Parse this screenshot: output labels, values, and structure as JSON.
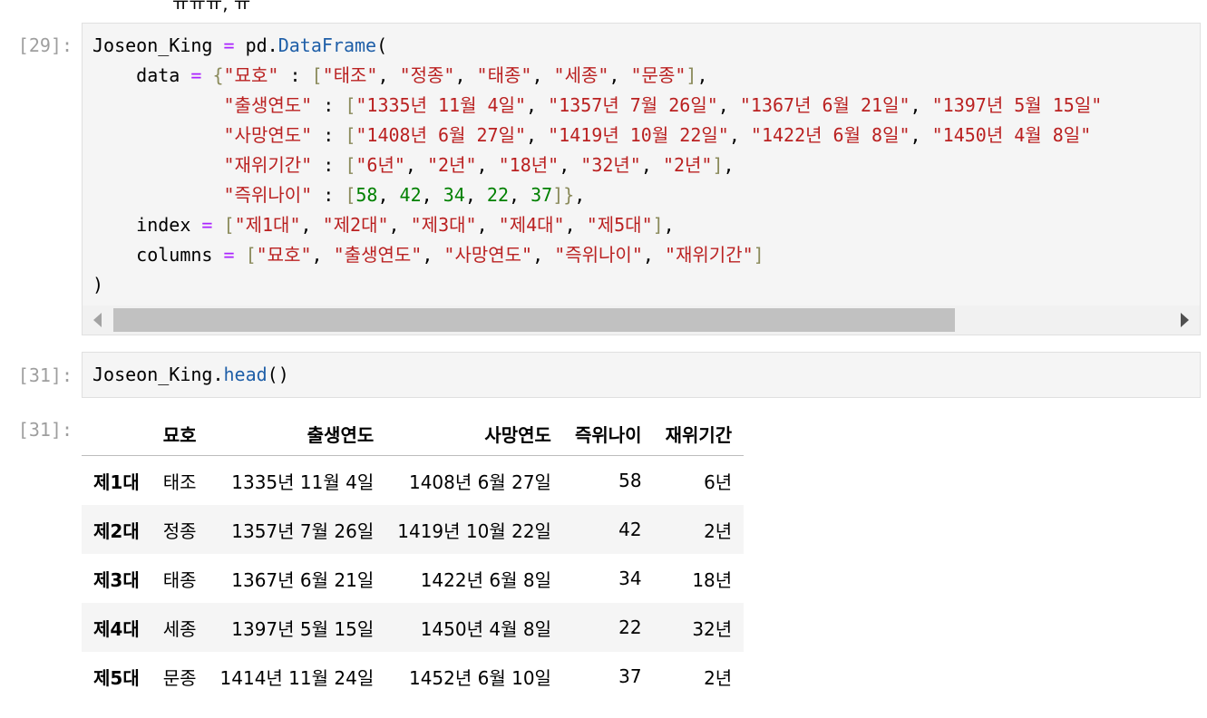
{
  "top_fragment": "ㅠㅠㅠ, ㅠ",
  "cells": [
    {
      "prompt": "[29]:",
      "code_lines": [
        [
          [
            "var",
            "Joseon_King "
          ],
          [
            "op",
            "="
          ],
          [
            "var",
            " pd."
          ],
          [
            "fn",
            "DataFrame"
          ],
          [
            "br",
            "("
          ]
        ],
        [
          [
            "var",
            "    data "
          ],
          [
            "op",
            "="
          ],
          [
            "var",
            " "
          ],
          [
            "brc",
            "{"
          ],
          [
            "str",
            "\"묘호\""
          ],
          [
            "var",
            " : "
          ],
          [
            "brc",
            "["
          ],
          [
            "str",
            "\"태조\""
          ],
          [
            "var",
            ", "
          ],
          [
            "str",
            "\"정종\""
          ],
          [
            "var",
            ", "
          ],
          [
            "str",
            "\"태종\""
          ],
          [
            "var",
            ", "
          ],
          [
            "str",
            "\"세종\""
          ],
          [
            "var",
            ", "
          ],
          [
            "str",
            "\"문종\""
          ],
          [
            "brc",
            "]"
          ],
          [
            "var",
            ","
          ]
        ],
        [
          [
            "var",
            "            "
          ],
          [
            "str",
            "\"출생연도\""
          ],
          [
            "var",
            " : "
          ],
          [
            "brc",
            "["
          ],
          [
            "str",
            "\"1335년 11월 4일\""
          ],
          [
            "var",
            ", "
          ],
          [
            "str",
            "\"1357년 7월 26일\""
          ],
          [
            "var",
            ", "
          ],
          [
            "str",
            "\"1367년 6월 21일\""
          ],
          [
            "var",
            ", "
          ],
          [
            "str",
            "\"1397년 5월 15일\""
          ]
        ],
        [
          [
            "var",
            "            "
          ],
          [
            "str",
            "\"사망연도\""
          ],
          [
            "var",
            " : "
          ],
          [
            "brc",
            "["
          ],
          [
            "str",
            "\"1408년 6월 27일\""
          ],
          [
            "var",
            ", "
          ],
          [
            "str",
            "\"1419년 10월 22일\""
          ],
          [
            "var",
            ", "
          ],
          [
            "str",
            "\"1422년 6월 8일\""
          ],
          [
            "var",
            ", "
          ],
          [
            "str",
            "\"1450년 4월 8일\""
          ]
        ],
        [
          [
            "var",
            "            "
          ],
          [
            "str",
            "\"재위기간\""
          ],
          [
            "var",
            " : "
          ],
          [
            "brc",
            "["
          ],
          [
            "str",
            "\"6년\""
          ],
          [
            "var",
            ", "
          ],
          [
            "str",
            "\"2년\""
          ],
          [
            "var",
            ", "
          ],
          [
            "str",
            "\"18년\""
          ],
          [
            "var",
            ", "
          ],
          [
            "str",
            "\"32년\""
          ],
          [
            "var",
            ", "
          ],
          [
            "str",
            "\"2년\""
          ],
          [
            "brc",
            "]"
          ],
          [
            "var",
            ","
          ]
        ],
        [
          [
            "var",
            "            "
          ],
          [
            "str",
            "\"즉위나이\""
          ],
          [
            "var",
            " : "
          ],
          [
            "brc",
            "["
          ],
          [
            "num",
            "58"
          ],
          [
            "var",
            ", "
          ],
          [
            "num",
            "42"
          ],
          [
            "var",
            ", "
          ],
          [
            "num",
            "34"
          ],
          [
            "var",
            ", "
          ],
          [
            "num",
            "22"
          ],
          [
            "var",
            ", "
          ],
          [
            "num",
            "37"
          ],
          [
            "brc",
            "]}"
          ],
          [
            "var",
            ","
          ]
        ],
        [
          [
            "var",
            "    index "
          ],
          [
            "op",
            "="
          ],
          [
            "var",
            " "
          ],
          [
            "brc",
            "["
          ],
          [
            "str",
            "\"제1대\""
          ],
          [
            "var",
            ", "
          ],
          [
            "str",
            "\"제2대\""
          ],
          [
            "var",
            ", "
          ],
          [
            "str",
            "\"제3대\""
          ],
          [
            "var",
            ", "
          ],
          [
            "str",
            "\"제4대\""
          ],
          [
            "var",
            ", "
          ],
          [
            "str",
            "\"제5대\""
          ],
          [
            "brc",
            "]"
          ],
          [
            "var",
            ","
          ]
        ],
        [
          [
            "var",
            "    columns "
          ],
          [
            "op",
            "="
          ],
          [
            "var",
            " "
          ],
          [
            "brc",
            "["
          ],
          [
            "str",
            "\"묘호\""
          ],
          [
            "var",
            ", "
          ],
          [
            "str",
            "\"출생연도\""
          ],
          [
            "var",
            ", "
          ],
          [
            "str",
            "\"사망연도\""
          ],
          [
            "var",
            ", "
          ],
          [
            "str",
            "\"즉위나이\""
          ],
          [
            "var",
            ", "
          ],
          [
            "str",
            "\"재위기간\""
          ],
          [
            "brc",
            "]"
          ]
        ],
        [
          [
            "br",
            ")"
          ]
        ]
      ]
    },
    {
      "prompt": "[31]:",
      "code_lines": [
        [
          [
            "var",
            "Joseon_King."
          ],
          [
            "fn",
            "head"
          ],
          [
            "br",
            "()"
          ]
        ]
      ]
    }
  ],
  "output": {
    "prompt": "[31]:",
    "columns": [
      "",
      "묘호",
      "출생연도",
      "사망연도",
      "즉위나이",
      "재위기간"
    ],
    "rows": [
      [
        "제1대",
        "태조",
        "1335년 11월 4일",
        "1408년 6월 27일",
        "58",
        "6년"
      ],
      [
        "제2대",
        "정종",
        "1357년 7월 26일",
        "1419년 10월 22일",
        "42",
        "2년"
      ],
      [
        "제3대",
        "태종",
        "1367년 6월 21일",
        "1422년 6월 8일",
        "34",
        "18년"
      ],
      [
        "제4대",
        "세종",
        "1397년 5월 15일",
        "1450년 4월 8일",
        "22",
        "32년"
      ],
      [
        "제5대",
        "문종",
        "1414년 11월 24일",
        "1452년 6월 10일",
        "37",
        "2년"
      ]
    ]
  },
  "colors": {
    "string": "#ba2121",
    "number": "#008000",
    "operator": "#aa22ff",
    "function": "#1f5fa8",
    "prompt": "#9e9e9e",
    "cell_bg": "#f5f5f5"
  }
}
